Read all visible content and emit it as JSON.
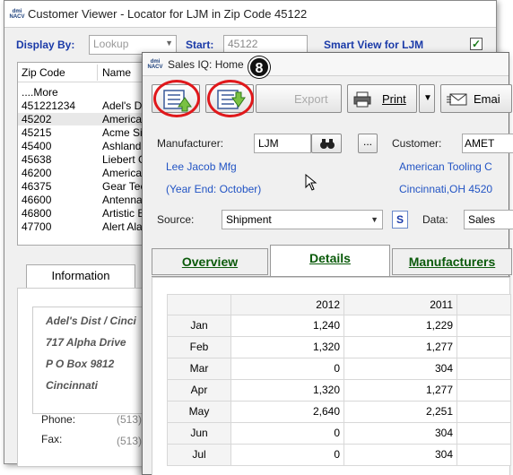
{
  "back_window": {
    "title": "Customer Viewer - Locator for LJM in Zip Code 45122",
    "display_by_label": "Display By:",
    "display_by_value": "Lookup",
    "start_label": "Start:",
    "start_value": "45122",
    "smart_view_label": "Smart View for LJM",
    "smart_view_checked": "✓",
    "list_columns": [
      "Zip Code",
      "Name"
    ],
    "list_rows": [
      {
        "zip": "....More",
        "name": ""
      },
      {
        "zip": "451221234",
        "name": "Adel's Dis"
      },
      {
        "zip": "45202",
        "name": "American"
      },
      {
        "zip": "45215",
        "name": "Acme Sig"
      },
      {
        "zip": "45400",
        "name": "Ashland"
      },
      {
        "zip": "45638",
        "name": "Liebert C"
      },
      {
        "zip": "46200",
        "name": "American"
      },
      {
        "zip": "46375",
        "name": "Gear Tec"
      },
      {
        "zip": "46600",
        "name": "Antenna"
      },
      {
        "zip": "46800",
        "name": "Artistic E"
      },
      {
        "zip": "47700",
        "name": "Alert Alar"
      }
    ],
    "info_tab": "Information",
    "address": [
      "Adel's Dist / Cinci",
      "717 Alpha Drive",
      "P O Box 9812",
      "Cincinnati"
    ],
    "phone_label": "Phone:",
    "phone_value": "(513)",
    "fax_label": "Fax:",
    "fax_value": "(513)"
  },
  "front_window": {
    "title": "Sales IQ: Home",
    "badge": "8",
    "toolbar": {
      "export_label": "Export",
      "print_label": "Print",
      "email_label": "Emai"
    },
    "manufacturer_label": "Manufacturer:",
    "manufacturer_value": "LJM",
    "customer_label": "Customer:",
    "customer_value": "AMET",
    "manufacturer_name": "Lee Jacob Mfg",
    "year_end": "(Year End: October)",
    "customer_name": "American Tooling C",
    "customer_city": "Cincinnati,OH 4520",
    "source_label": "Source:",
    "source_value": "Shipment",
    "source_s_button": "S",
    "data_label": "Data:",
    "data_value": "Sales",
    "tabs": [
      "Overview",
      "Details",
      "Manufacturers"
    ],
    "grid": {
      "years": [
        "2012",
        "2011"
      ],
      "rows": [
        {
          "month": "Jan",
          "v2012": "1,240",
          "v2011": "1,229"
        },
        {
          "month": "Feb",
          "v2012": "1,320",
          "v2011": "1,277"
        },
        {
          "month": "Mar",
          "v2012": "0",
          "v2011": "304"
        },
        {
          "month": "Apr",
          "v2012": "1,320",
          "v2011": "1,277"
        },
        {
          "month": "May",
          "v2012": "2,640",
          "v2011": "2,251"
        },
        {
          "month": "Jun",
          "v2012": "0",
          "v2011": "304"
        },
        {
          "month": "Jul",
          "v2012": "0",
          "v2011": "304"
        }
      ]
    }
  },
  "colors": {
    "highlight_ring": "#e0181b",
    "label_blue": "#1a3aa8",
    "link_blue": "#2254c4",
    "tab_green": "#0a5a0a"
  }
}
